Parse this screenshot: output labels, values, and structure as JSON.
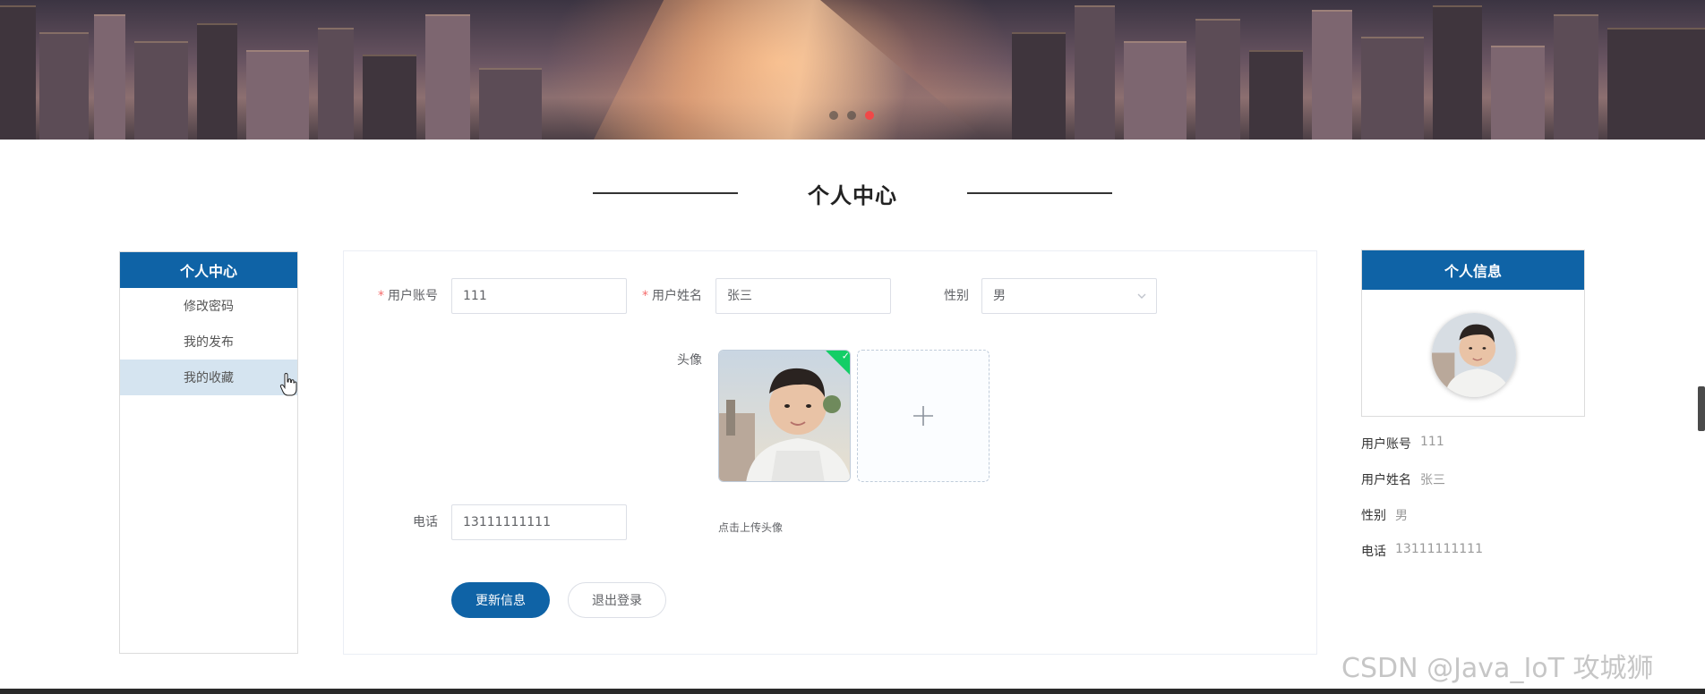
{
  "page": {
    "section_title": "个人中心"
  },
  "banner": {
    "dots": 3,
    "active_dot": 3
  },
  "left_menu": {
    "header": "个人中心",
    "items": [
      {
        "label": "修改密码",
        "active": false
      },
      {
        "label": "我的发布",
        "active": false
      },
      {
        "label": "我的收藏",
        "active": true
      }
    ]
  },
  "form": {
    "account": {
      "label": "用户账号",
      "value": "111",
      "required": true
    },
    "name": {
      "label": "用户姓名",
      "value": "张三",
      "required": true
    },
    "gender": {
      "label": "性别",
      "value": "男"
    },
    "avatar": {
      "label": "头像",
      "tip": "点击上传头像"
    },
    "phone": {
      "label": "电话",
      "value": "13111111111"
    },
    "update_button": "更新信息",
    "logout_button": "退出登录"
  },
  "profile": {
    "header": "个人信息",
    "rows": [
      {
        "label": "用户账号",
        "value": "111"
      },
      {
        "label": "用户姓名",
        "value": "张三"
      },
      {
        "label": "性别",
        "value": "男"
      },
      {
        "label": "电话",
        "value": "13111111111"
      }
    ]
  },
  "colors": {
    "primary": "#0f63a6",
    "active_menu_bg": "#d5e4f0",
    "required_star": "#f56c6c",
    "upload_success": "#13ce66",
    "active_dot": "#f04848"
  },
  "icons": {
    "select": "chevron-down-icon",
    "upload": "plus-icon",
    "upload_success": "check-icon",
    "pointer": "hand-cursor-icon"
  },
  "watermark": "CSDN @Java_IoT 攻城狮"
}
